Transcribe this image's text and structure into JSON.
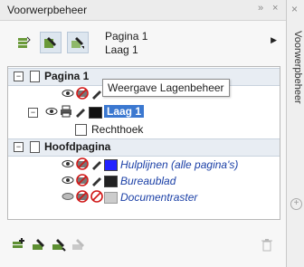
{
  "panel": {
    "title": "Voorwerpbeheer",
    "collapse_glyph": "»",
    "close_glyph": "×"
  },
  "toolbar": {
    "page_name": "Pagina 1",
    "layer_name": "Laag 1",
    "flyout_glyph": "▶"
  },
  "tooltip": "Weergave Lagenbeheer",
  "tree": {
    "page1": {
      "label": "Pagina 1"
    },
    "layer1": {
      "label": "Laag 1",
      "color": "#111111"
    },
    "rect": {
      "label": "Rechthoek"
    },
    "masterpage": {
      "label": "Hoofdpagina"
    },
    "guides": {
      "label": "Hulplijnen (alle pagina's)",
      "color": "#2222ff"
    },
    "desktop": {
      "label": "Bureaublad",
      "color": "#222222"
    },
    "grid": {
      "label": "Documentraster",
      "color": "#cccccc"
    }
  },
  "side_tab": {
    "label": "Voorwerpbeheer",
    "icon": "plus-circle-icon"
  },
  "colors": {
    "selection": "#3b78d0",
    "header_bg": "#e8edf3"
  }
}
